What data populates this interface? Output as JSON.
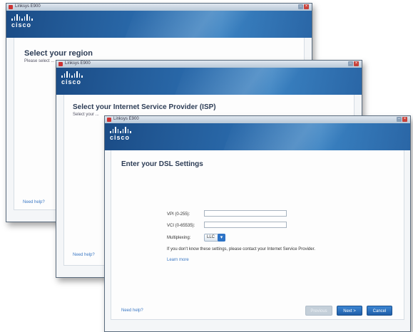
{
  "windows": [
    {
      "title": "Linksys E900",
      "brand": "cisco",
      "heading": "Select your region",
      "subtext": "Please select ...",
      "need_help": "Need help?"
    },
    {
      "title": "Linksys E900",
      "brand": "cisco",
      "heading": "Select your Internet Service Provider (ISP)",
      "subtext": "Select your ...",
      "need_help": "Need help?"
    },
    {
      "title": "Linksys E900",
      "brand": "cisco",
      "heading": "Enter your DSL Settings",
      "fields": [
        {
          "label": "VPI (0-255):",
          "value": ""
        },
        {
          "label": "VCI (0-65535):",
          "value": ""
        }
      ],
      "multiplexing_label": "Multiplexing:",
      "multiplexing_value": "LLC",
      "info_text": "If you don't know these settings, please contact your Internet Service Provider.",
      "learn_more": "Learn more",
      "need_help": "Need help?",
      "buttons": {
        "previous": "Previous",
        "next": "Next >",
        "cancel": "Cancel"
      }
    }
  ],
  "colors": {
    "banner": "#2a6aab",
    "primary_button": "#2d73c6",
    "link": "#3b78c4"
  }
}
